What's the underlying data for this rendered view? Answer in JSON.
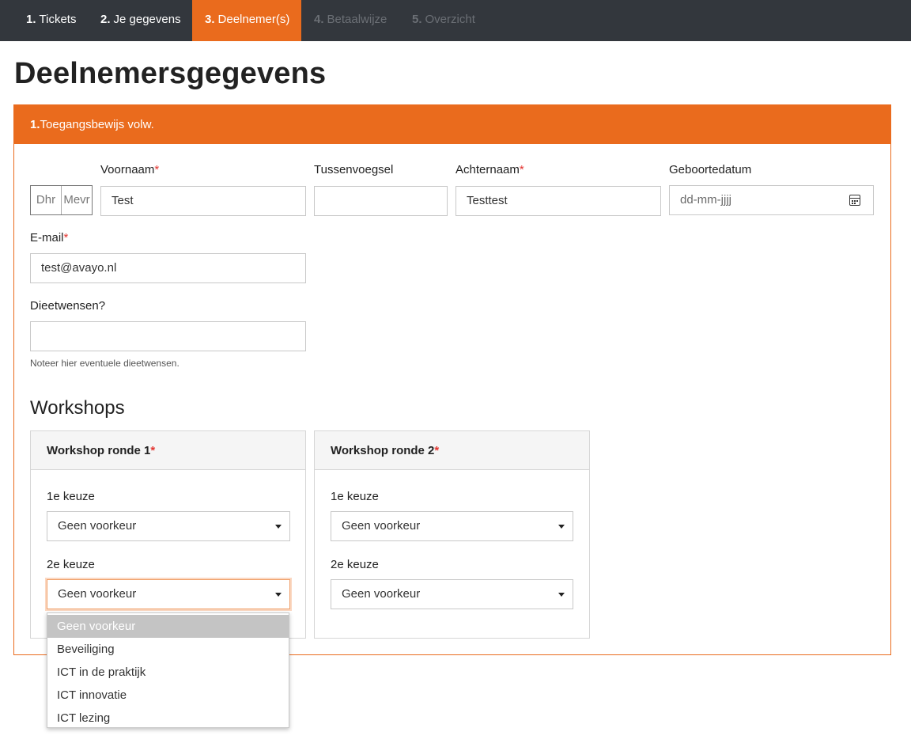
{
  "steps": [
    {
      "num": "1.",
      "label": "Tickets"
    },
    {
      "num": "2.",
      "label": "Je gegevens"
    },
    {
      "num": "3.",
      "label": "Deelnemer(s)"
    },
    {
      "num": "4.",
      "label": "Betaalwijze"
    },
    {
      "num": "5.",
      "label": "Overzicht"
    }
  ],
  "page_title": "Deelnemersgegevens",
  "ticket": {
    "num": "1.",
    "name": "Toegangsbewijs volw."
  },
  "salutation": {
    "options": [
      "Dhr",
      "Mevr"
    ]
  },
  "fields": {
    "voornaam": {
      "label": "Voornaam",
      "value": "Test"
    },
    "tussenvoegsel": {
      "label": "Tussenvoegsel",
      "value": ""
    },
    "achternaam": {
      "label": "Achternaam",
      "value": "Testtest"
    },
    "geboortedatum": {
      "label": "Geboortedatum",
      "placeholder": "dd-mm-jjjj"
    },
    "email": {
      "label": "E-mail",
      "value": "test@avayo.nl"
    },
    "dieet": {
      "label": "Dieetwensen?",
      "value": "",
      "help": "Noteer hier eventuele dieetwensen."
    }
  },
  "required_mark": "*",
  "workshops": {
    "title": "Workshops",
    "rounds": [
      {
        "title": "Workshop ronde 1",
        "choice1_label": "1e keuze",
        "choice1_value": "Geen voorkeur",
        "choice2_label": "2e keuze",
        "choice2_value": "Geen voorkeur"
      },
      {
        "title": "Workshop ronde 2",
        "choice1_label": "1e keuze",
        "choice1_value": "Geen voorkeur",
        "choice2_label": "2e keuze",
        "choice2_value": "Geen voorkeur"
      }
    ]
  },
  "dropdown_options": [
    "Geen voorkeur",
    "Beveiliging",
    "ICT in de praktijk",
    "ICT innovatie",
    "ICT lezing"
  ],
  "colors": {
    "accent": "#ea6b1d",
    "nav_bg": "#33373d",
    "required": "#e3342f"
  }
}
